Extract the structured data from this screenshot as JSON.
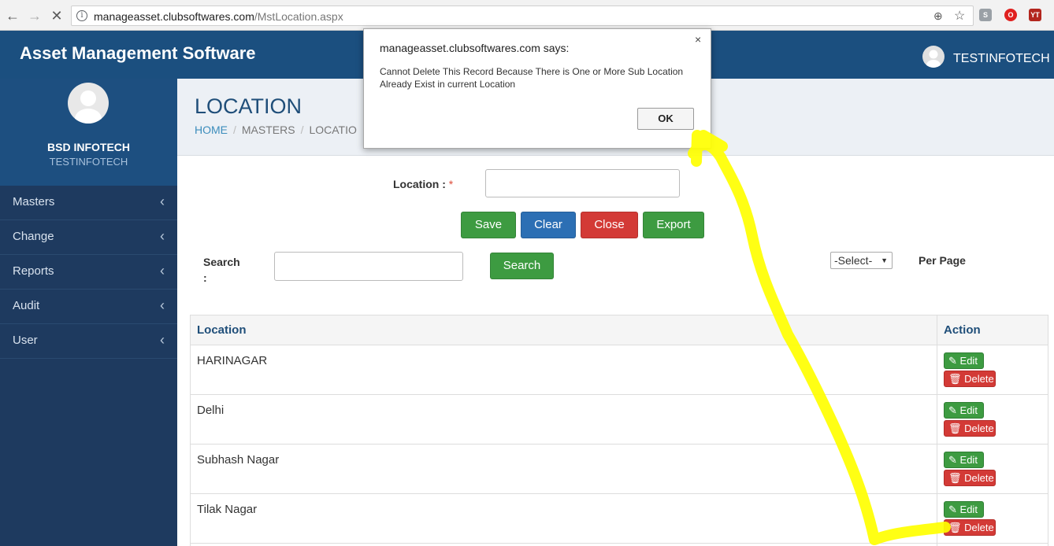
{
  "browser": {
    "url_host": "manageasset.clubsoftwares.com",
    "url_path": "/MstLocation.aspx"
  },
  "header": {
    "brand": "Asset Management Software",
    "user_name": "TESTINFOTECH"
  },
  "sidebar": {
    "company": "BSD INFOTECH",
    "user": "TESTINFOTECH",
    "items": [
      {
        "label": "Masters"
      },
      {
        "label": "Change"
      },
      {
        "label": "Reports"
      },
      {
        "label": "Audit"
      },
      {
        "label": "User"
      }
    ]
  },
  "page": {
    "title": "LOCATION",
    "breadcrumb": [
      "HOME",
      "MASTERS",
      "LOCATIO"
    ]
  },
  "form": {
    "location_label": "Location :",
    "required_mark": "*",
    "location_value": "",
    "buttons": {
      "save": "Save",
      "clear": "Clear",
      "close": "Close",
      "export": "Export"
    },
    "search_label_1": "Search",
    "search_label_2": ":",
    "search_value": "",
    "search_button": "Search",
    "page_size_selected": "-Select-",
    "per_page_label": "Per Page"
  },
  "table": {
    "headers": {
      "location": "Location",
      "action": "Action"
    },
    "edit_label": "Edit",
    "delete_label": "Delete",
    "rows": [
      {
        "location": "HARINAGAR"
      },
      {
        "location": "Delhi"
      },
      {
        "location": "Subhash Nagar"
      },
      {
        "location": "Tilak Nagar"
      }
    ]
  },
  "dialog": {
    "title": "manageasset.clubsoftwares.com says:",
    "message": "Cannot Delete This Record Because There is One or More Sub Location Already Exist in current Location",
    "ok_label": "OK",
    "close_glyph": "×"
  },
  "colors": {
    "header": "#1b4f7f",
    "sidebar": "#1e3a5f",
    "annotation": "#ffff00"
  }
}
